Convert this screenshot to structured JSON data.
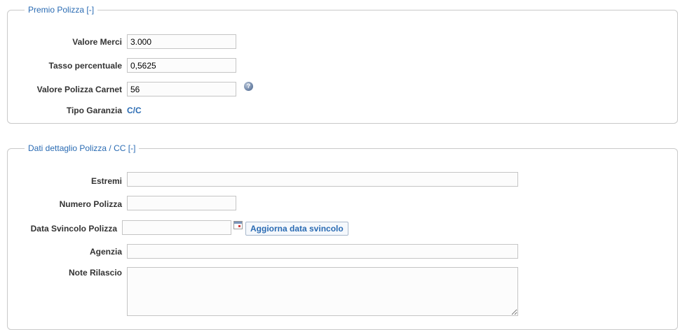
{
  "premio": {
    "legend": "Premio Polizza",
    "toggle": "[-]",
    "valore_merci_label": "Valore Merci",
    "valore_merci_value": "3.000",
    "tasso_label": "Tasso percentuale",
    "tasso_value": "0,5625",
    "valore_polizza_label": "Valore Polizza Carnet",
    "valore_polizza_value": "56",
    "tipo_garanzia_label": "Tipo Garanzia",
    "tipo_garanzia_value": "C/C",
    "help_glyph": "?"
  },
  "dettaglio": {
    "legend": "Dati dettaglio Polizza / CC",
    "toggle": "[-]",
    "estremi_label": "Estremi",
    "estremi_value": "",
    "numero_label": "Numero Polizza",
    "numero_value": "",
    "data_svincolo_label": "Data Svincolo Polizza",
    "data_svincolo_value": "",
    "aggiorna_button": "Aggiorna data svincolo",
    "agenzia_label": "Agenzia",
    "agenzia_value": "",
    "note_label": "Note Rilascio",
    "note_value": ""
  },
  "icons": {
    "help": "help-icon",
    "calendar": "calendar-icon"
  },
  "colors": {
    "accent": "#2a6bb3",
    "border": "#c9c9c9"
  }
}
